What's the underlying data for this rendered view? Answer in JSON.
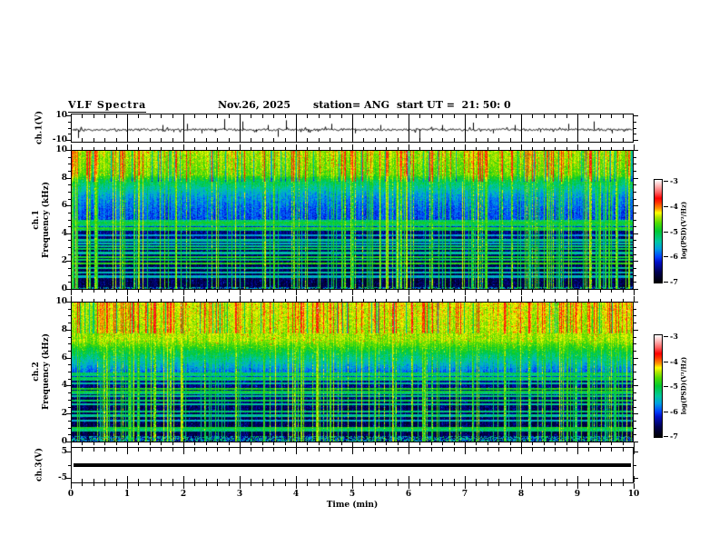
{
  "title": {
    "main": "VLF Spectra",
    "date": "Nov.26, 2025",
    "station": "station= ANG",
    "start_ut": "start UT =  21: 50: 0"
  },
  "axes": {
    "time": {
      "label": "Time (min)",
      "min": 0,
      "max": 10,
      "major_tick_labels": [
        "0",
        "1",
        "2",
        "3",
        "4",
        "5",
        "6",
        "7",
        "8",
        "9",
        "10"
      ],
      "minor_step_min": 0.2
    },
    "wave1": {
      "label": "ch.1(V)",
      "tick_values": [
        10,
        -10
      ],
      "tick_labels": [
        "10",
        "-10"
      ],
      "range_V": [
        -10,
        10
      ]
    },
    "spec1": {
      "label_line1": "ch.1",
      "label_line2": "Frequency (kHz)",
      "tick_values": [
        0,
        2,
        4,
        6,
        8,
        10
      ],
      "tick_labels": [
        "0",
        "2",
        "4",
        "6",
        "8",
        "10"
      ],
      "range_kHz": [
        0,
        10
      ],
      "minor_step_kHz": 0.5
    },
    "spec2": {
      "label_line1": "ch.2",
      "label_line2": "Frequency (kHz)",
      "tick_values": [
        0,
        2,
        4,
        6,
        8,
        10
      ],
      "tick_labels": [
        "0",
        "2",
        "4",
        "6",
        "8",
        "10"
      ],
      "range_kHz": [
        0,
        10
      ],
      "minor_step_kHz": 0.5
    },
    "wave3": {
      "label": "ch.3(V)",
      "tick_values": [
        5,
        -5
      ],
      "tick_labels": [
        "5",
        "-5"
      ],
      "range_V": [
        -5,
        5
      ]
    }
  },
  "colorbar": {
    "label": "log(PSD)(V²/Hz)",
    "tick_labels": [
      "-3",
      "-4",
      "-5",
      "-6",
      "-7"
    ],
    "tick_values": [
      -3,
      -4,
      -5,
      -6,
      -7
    ],
    "range": [
      -7,
      -3
    ],
    "stops": [
      [
        0.0,
        "#000000"
      ],
      [
        0.1,
        "#000050"
      ],
      [
        0.2,
        "#0010c8"
      ],
      [
        0.25,
        "#0040ff"
      ],
      [
        0.33,
        "#00a0e0"
      ],
      [
        0.4,
        "#00c8a0"
      ],
      [
        0.5,
        "#00c832"
      ],
      [
        0.58,
        "#50dc00"
      ],
      [
        0.64,
        "#b4e600"
      ],
      [
        0.68,
        "#ffff00"
      ],
      [
        0.72,
        "#ff9600"
      ],
      [
        0.78,
        "#ff3200"
      ],
      [
        0.82,
        "#ff0000"
      ],
      [
        0.88,
        "#ff6464"
      ],
      [
        0.94,
        "#ffb4b4"
      ],
      [
        1.0,
        "#ffffff"
      ]
    ]
  },
  "chart_data": [
    {
      "type": "line",
      "name": "ch1_waveform",
      "x_range_min": [
        0,
        10
      ],
      "y_range_V": [
        -10,
        10
      ],
      "baseline_V": -1,
      "noise_V": 1.0,
      "seed": 77,
      "spikes_t_min_amp_V": [
        [
          0.11,
          -8
        ],
        [
          1.62,
          3
        ],
        [
          1.82,
          -3
        ],
        [
          2.05,
          4
        ],
        [
          2.32,
          -4
        ],
        [
          2.55,
          -3
        ],
        [
          2.72,
          8
        ],
        [
          3.05,
          6
        ],
        [
          3.28,
          -3
        ],
        [
          3.5,
          3
        ],
        [
          3.68,
          -7
        ],
        [
          3.82,
          7
        ],
        [
          4.2,
          -3
        ],
        [
          4.62,
          4
        ],
        [
          5.05,
          -4
        ],
        [
          5.5,
          3
        ],
        [
          6.2,
          -10
        ],
        [
          6.6,
          3
        ],
        [
          7.15,
          5
        ],
        [
          7.5,
          -4
        ],
        [
          7.9,
          3
        ],
        [
          8.35,
          -3
        ],
        [
          8.85,
          4
        ],
        [
          9.3,
          6
        ],
        [
          9.62,
          -4
        ]
      ]
    },
    {
      "type": "heatmap",
      "name": "ch1_spectrogram",
      "x_range_min": [
        0,
        10
      ],
      "y_range_kHz": [
        0,
        10
      ],
      "z_log_psd_range": [
        -7,
        -3
      ],
      "seed": 1234,
      "profile_kHz_value": [
        [
          10,
          0.63
        ],
        [
          8.3,
          0.58
        ],
        [
          7.9,
          0.48
        ],
        [
          6.8,
          0.33
        ],
        [
          5.8,
          0.27
        ],
        [
          5.0,
          0.25
        ],
        [
          4.4,
          0.23
        ],
        [
          4.25,
          0.14
        ],
        [
          3.0,
          0.115
        ],
        [
          1.5,
          0.1
        ],
        [
          0,
          0.09
        ]
      ],
      "harmonic_lines_kHz_value": [
        [
          4.95,
          0.44
        ],
        [
          4.8,
          0.5
        ],
        [
          4.62,
          0.44
        ],
        [
          4.45,
          0.52
        ],
        [
          4.3,
          0.46
        ],
        [
          3.9,
          0.34
        ],
        [
          3.55,
          0.4
        ],
        [
          3.32,
          0.38
        ],
        [
          3.15,
          0.42
        ],
        [
          2.9,
          0.46
        ],
        [
          2.63,
          0.4
        ],
        [
          2.32,
          0.5
        ],
        [
          2.15,
          0.46
        ],
        [
          1.85,
          0.54
        ],
        [
          1.55,
          0.42
        ],
        [
          1.22,
          0.38
        ],
        [
          0.92,
          0.36
        ]
      ],
      "streak_density": 0.2,
      "red_streak_density": 0.055,
      "cold_column_density": 0.09,
      "bottom_strip_kHz": 0.18
    },
    {
      "type": "heatmap",
      "name": "ch2_spectrogram",
      "x_range_min": [
        0,
        10
      ],
      "y_range_kHz": [
        0,
        10
      ],
      "z_log_psd_range": [
        -7,
        -3
      ],
      "seed": 5678,
      "profile_kHz_value": [
        [
          10,
          0.66
        ],
        [
          7.3,
          0.62
        ],
        [
          6.3,
          0.46
        ],
        [
          5.3,
          0.32
        ],
        [
          4.7,
          0.24
        ],
        [
          4.45,
          0.15
        ],
        [
          3.0,
          0.115
        ],
        [
          1.5,
          0.1
        ],
        [
          0,
          0.09
        ]
      ],
      "harmonic_lines_kHz_value": [
        [
          4.95,
          0.46
        ],
        [
          4.78,
          0.43
        ],
        [
          4.62,
          0.48
        ],
        [
          4.45,
          0.44
        ],
        [
          4.2,
          0.4
        ],
        [
          3.82,
          0.52
        ],
        [
          3.65,
          0.5
        ],
        [
          3.48,
          0.44
        ],
        [
          3.3,
          0.42
        ],
        [
          3.0,
          0.46
        ],
        [
          2.7,
          0.4
        ],
        [
          2.2,
          0.44
        ],
        [
          1.9,
          0.4
        ],
        [
          1.55,
          0.36
        ],
        [
          1.02,
          0.5
        ],
        [
          0.85,
          0.44
        ]
      ],
      "streak_density": 0.22,
      "red_streak_density": 0.075,
      "cold_column_density": 0.08,
      "bottom_strip_kHz": 0.4
    },
    {
      "type": "line",
      "name": "ch3_waveform",
      "x_range_min": [
        0,
        10
      ],
      "y_range_V": [
        -5,
        5
      ],
      "constant_V": 0
    }
  ]
}
